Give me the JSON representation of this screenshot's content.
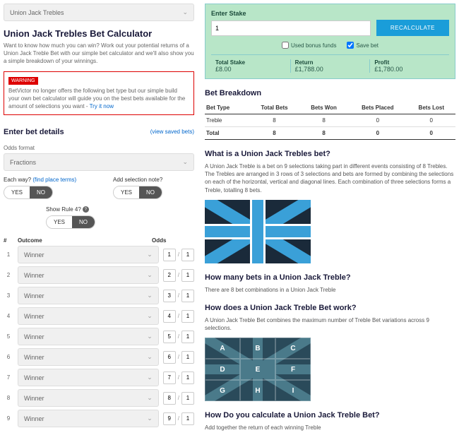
{
  "left": {
    "betType": "Union Jack Trebles",
    "title": "Union Jack Trebles Bet Calculator",
    "intro": "Want to know how much you can win? Work out your potential returns of a Union Jack Treble Bet with our simple bet calculator and we'll also show you a simple breakdown of your winnings.",
    "warnTag": "WARNING",
    "warnText": "BetVictor no longer offers the following bet type but our simple build your own bet calculator will guide you on the best bets available for the amount of selections you want - ",
    "warnLink": "Try it now",
    "detailsHdr": "Enter bet details",
    "savedLink": "(view saved bets)",
    "oddsFmtLbl": "Odds format",
    "oddsFmt": "Fractions",
    "eachWayLbl": "Each way?",
    "placeTerms": "(find place terms)",
    "noteLbl": "Add selection note?",
    "ruleLbl": "Show Rule 4?",
    "yes": "YES",
    "no": "NO",
    "colNum": "#",
    "colOutcome": "Outcome",
    "colOdds": "Odds",
    "rows": [
      {
        "n": "1",
        "outcome": "Winner",
        "a": "1",
        "b": "1"
      },
      {
        "n": "2",
        "outcome": "Winner",
        "a": "2",
        "b": "1"
      },
      {
        "n": "3",
        "outcome": "Winner",
        "a": "3",
        "b": "1"
      },
      {
        "n": "4",
        "outcome": "Winner",
        "a": "4",
        "b": "1"
      },
      {
        "n": "5",
        "outcome": "Winner",
        "a": "5",
        "b": "1"
      },
      {
        "n": "6",
        "outcome": "Winner",
        "a": "6",
        "b": "1"
      },
      {
        "n": "7",
        "outcome": "Winner",
        "a": "7",
        "b": "1"
      },
      {
        "n": "8",
        "outcome": "Winner",
        "a": "8",
        "b": "1"
      },
      {
        "n": "9",
        "outcome": "Winner",
        "a": "9",
        "b": "1"
      }
    ]
  },
  "right": {
    "stakeLbl": "Enter Stake",
    "stakeVal": "1",
    "recalc": "RECALCULATE",
    "bonusLbl": "Used bonus funds",
    "saveLbl": "Save bet",
    "totStakeLbl": "Total Stake",
    "totStakeVal": "£8.00",
    "returnLbl": "Return",
    "returnVal": "£1,788.00",
    "profitLbl": "Profit",
    "profitVal": "£1,780.00",
    "breakHdr": "Bet Breakdown",
    "bt": {
      "h": [
        "Bet Type",
        "Total Bets",
        "Bets Won",
        "Bets Placed",
        "Bets Lost"
      ],
      "r1": [
        "Treble",
        "8",
        "8",
        "0",
        "0"
      ],
      "r2": [
        "Total",
        "8",
        "8",
        "0",
        "0"
      ]
    },
    "q1": "What is a Union Jack Trebles bet?",
    "a1": "A Union Jack Treble is a bet on 9 selections taking part in different events consisting of 8 Trebles. The Trebles are arranged in 3 rows of 3 selections and bets are formed by combining the selections on each of the horizontal, vertical and diagonal lines. Each combination of three selections forms a Treble, totalling 8 bets.",
    "q2": "How many bets in a Union Jack Treble?",
    "a2": "There are 8 bet combinations in a Union Jack Treble",
    "q3": "How does a Union Jack Treble Bet work?",
    "a3": "A Union Jack Treble Bet combines the maximum number of Treble Bet variations across 9 selections.",
    "grid": [
      "A",
      "B",
      "C",
      "D",
      "E",
      "F",
      "G",
      "H",
      "I"
    ],
    "q4": "How Do you calculate a Union Jack Treble Bet?",
    "a4": "Add together the return of each winning Treble"
  }
}
